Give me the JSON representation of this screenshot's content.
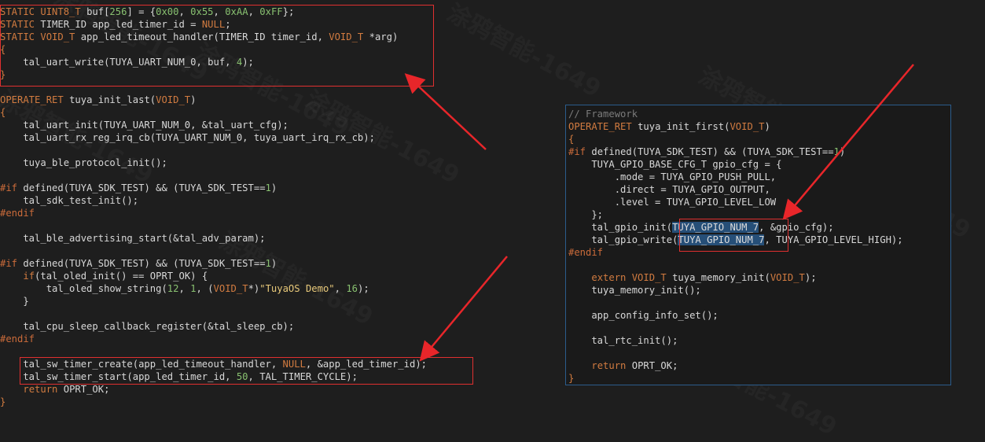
{
  "watermark": "涂鸦智能-1649",
  "left_code": [
    [
      [
        "kw",
        "STATIC UINT8_T "
      ],
      [
        "pl",
        "buf["
      ],
      [
        "num",
        "256"
      ],
      [
        "pl",
        "] = {"
      ],
      [
        "num",
        "0x00"
      ],
      [
        "pl",
        ", "
      ],
      [
        "num",
        "0x55"
      ],
      [
        "pl",
        ", "
      ],
      [
        "num",
        "0xAA"
      ],
      [
        "pl",
        ", "
      ],
      [
        "num",
        "0xFF"
      ],
      [
        "pl",
        "};"
      ]
    ],
    [
      [
        "kw",
        "STATIC "
      ],
      [
        "pl",
        "TIMER_ID app_led_timer_id = "
      ],
      [
        "kw",
        "NULL"
      ],
      [
        "pl",
        ";"
      ]
    ],
    [
      [
        "kw",
        "STATIC VOID_T "
      ],
      [
        "pl",
        "app_led_timeout_handler(TIMER_ID timer_id, "
      ],
      [
        "kw",
        "VOID_T"
      ],
      [
        "pl",
        " *arg)"
      ]
    ],
    [
      [
        "kw",
        "{"
      ]
    ],
    [
      [
        "pl",
        "    tal_uart_write(TUYA_UART_NUM_0, buf, "
      ],
      [
        "num",
        "4"
      ],
      [
        "pl",
        ");"
      ]
    ],
    [
      [
        "kw",
        "}"
      ]
    ],
    [
      [
        "pl",
        ""
      ]
    ],
    [
      [
        "kw",
        "OPERATE_RET "
      ],
      [
        "pl",
        "tuya_init_last("
      ],
      [
        "kw",
        "VOID_T"
      ],
      [
        "pl",
        ")"
      ]
    ],
    [
      [
        "kw",
        "{"
      ]
    ],
    [
      [
        "pl",
        "    tal_uart_init(TUYA_UART_NUM_0, &tal_uart_cfg);"
      ]
    ],
    [
      [
        "pl",
        "    tal_uart_rx_reg_irq_cb(TUYA_UART_NUM_0, tuya_uart_irq_rx_cb);"
      ]
    ],
    [
      [
        "pl",
        ""
      ]
    ],
    [
      [
        "pl",
        "    tuya_ble_protocol_init();"
      ]
    ],
    [
      [
        "pl",
        ""
      ]
    ],
    [
      [
        "pp",
        "#if "
      ],
      [
        "pl",
        "defined(TUYA_SDK_TEST) && (TUYA_SDK_TEST=="
      ],
      [
        "num",
        "1"
      ],
      [
        "pl",
        ")"
      ]
    ],
    [
      [
        "pl",
        "    tal_sdk_test_init();"
      ]
    ],
    [
      [
        "pp",
        "#endif"
      ]
    ],
    [
      [
        "pl",
        ""
      ]
    ],
    [
      [
        "pl",
        "    tal_ble_advertising_start(&tal_adv_param);"
      ]
    ],
    [
      [
        "pl",
        ""
      ]
    ],
    [
      [
        "pp",
        "#if "
      ],
      [
        "pl",
        "defined(TUYA_SDK_TEST) && (TUYA_SDK_TEST=="
      ],
      [
        "num",
        "1"
      ],
      [
        "pl",
        ")"
      ]
    ],
    [
      [
        "pl",
        "    "
      ],
      [
        "kw",
        "if"
      ],
      [
        "pl",
        "(tal_oled_init() == OPRT_OK) {"
      ]
    ],
    [
      [
        "pl",
        "        tal_oled_show_string("
      ],
      [
        "num",
        "12"
      ],
      [
        "pl",
        ", "
      ],
      [
        "num",
        "1"
      ],
      [
        "pl",
        ", ("
      ],
      [
        "kw",
        "VOID_T"
      ],
      [
        "pl",
        "*)"
      ],
      [
        "str",
        "\"TuyaOS Demo\""
      ],
      [
        "pl",
        ", "
      ],
      [
        "num",
        "16"
      ],
      [
        "pl",
        ");"
      ]
    ],
    [
      [
        "pl",
        "    }"
      ]
    ],
    [
      [
        "pl",
        ""
      ]
    ],
    [
      [
        "pl",
        "    tal_cpu_sleep_callback_register(&tal_sleep_cb);"
      ]
    ],
    [
      [
        "pp",
        "#endif"
      ]
    ],
    [
      [
        "pl",
        ""
      ]
    ],
    [
      [
        "pl",
        "    tal_sw_timer_create(app_led_timeout_handler, "
      ],
      [
        "kw",
        "NULL"
      ],
      [
        "pl",
        ", &app_led_timer_id);"
      ]
    ],
    [
      [
        "pl",
        "    tal_sw_timer_start(app_led_timer_id, "
      ],
      [
        "num",
        "50"
      ],
      [
        "pl",
        ", TAL_TIMER_CYCLE);"
      ]
    ],
    [
      [
        "pl",
        "    "
      ],
      [
        "kw",
        "return"
      ],
      [
        "pl",
        " OPRT_OK;"
      ]
    ],
    [
      [
        "kw",
        "}"
      ]
    ]
  ],
  "right_code": [
    [
      [
        "cm",
        "// Framework"
      ]
    ],
    [
      [
        "kw",
        "OPERATE_RET "
      ],
      [
        "pl",
        "tuya_init_first("
      ],
      [
        "kw",
        "VOID_T"
      ],
      [
        "pl",
        ")"
      ]
    ],
    [
      [
        "kw",
        "{"
      ]
    ],
    [
      [
        "pp",
        "#if "
      ],
      [
        "pl",
        "defined(TUYA_SDK_TEST) && (TUYA_SDK_TEST=="
      ],
      [
        "num",
        "1"
      ],
      [
        "pl",
        ")"
      ]
    ],
    [
      [
        "pl",
        "    TUYA_GPIO_BASE_CFG_T gpio_cfg = {"
      ]
    ],
    [
      [
        "pl",
        "        .mode = TUYA_GPIO_PUSH_PULL,"
      ]
    ],
    [
      [
        "pl",
        "        .direct = TUYA_GPIO_OUTPUT,"
      ]
    ],
    [
      [
        "pl",
        "        .level = TUYA_GPIO_LEVEL_LOW"
      ]
    ],
    [
      [
        "pl",
        "    };"
      ]
    ],
    [
      [
        "pl",
        "    tal_gpio_init("
      ],
      [
        "sel",
        "TUYA_GPIO_NUM_7"
      ],
      [
        "pl",
        ", &gpio_cfg);"
      ]
    ],
    [
      [
        "pl",
        "    tal_gpio_write("
      ],
      [
        "sel",
        "TUYA_GPIO_NUM_7"
      ],
      [
        "pl",
        ", TUYA_GPIO_LEVEL_HIGH);"
      ]
    ],
    [
      [
        "pp",
        "#endif"
      ]
    ],
    [
      [
        "pl",
        ""
      ]
    ],
    [
      [
        "pl",
        "    "
      ],
      [
        "kw",
        "extern VOID_T "
      ],
      [
        "pl",
        "tuya_memory_init("
      ],
      [
        "kw",
        "VOID_T"
      ],
      [
        "pl",
        ");"
      ]
    ],
    [
      [
        "pl",
        "    tuya_memory_init();"
      ]
    ],
    [
      [
        "pl",
        ""
      ]
    ],
    [
      [
        "pl",
        "    app_config_info_set();"
      ]
    ],
    [
      [
        "pl",
        ""
      ]
    ],
    [
      [
        "pl",
        "    tal_rtc_init();"
      ]
    ],
    [
      [
        "pl",
        ""
      ]
    ],
    [
      [
        "pl",
        "    "
      ],
      [
        "kw",
        "return"
      ],
      [
        "pl",
        " OPRT_OK;"
      ]
    ],
    [
      [
        "kw",
        "}"
      ]
    ]
  ]
}
